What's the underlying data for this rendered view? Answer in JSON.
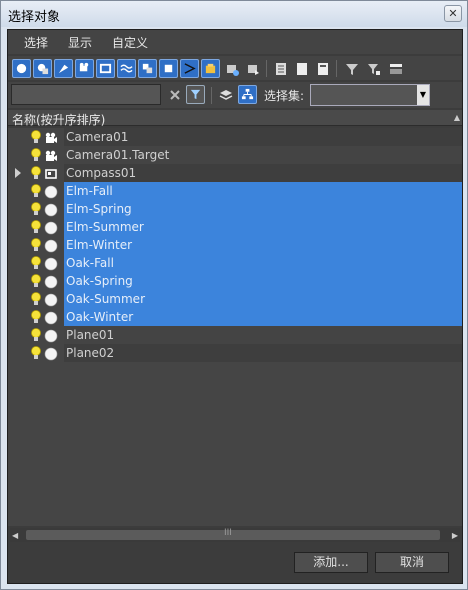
{
  "window": {
    "title": "选择对象",
    "close_glyph": "✕"
  },
  "menu": [
    "选择",
    "显示",
    "自定义"
  ],
  "filter": {
    "search_value": "",
    "selection_set_label": "选择集:",
    "selection_set_value": ""
  },
  "columns": {
    "name_header": "名称(按升序排序)"
  },
  "objects": [
    {
      "name": "Camera01",
      "icon": "camera-icon",
      "selected": false,
      "expandable": false
    },
    {
      "name": "Camera01.Target",
      "icon": "camera-icon",
      "selected": false,
      "expandable": false
    },
    {
      "name": "Compass01",
      "icon": "helper-icon",
      "selected": false,
      "expandable": true
    },
    {
      "name": "Elm-Fall",
      "icon": "geometry-sphere-icon",
      "selected": true,
      "expandable": false
    },
    {
      "name": "Elm-Spring",
      "icon": "geometry-sphere-icon",
      "selected": true,
      "expandable": false
    },
    {
      "name": "Elm-Summer",
      "icon": "geometry-sphere-icon",
      "selected": true,
      "expandable": false
    },
    {
      "name": "Elm-Winter",
      "icon": "geometry-sphere-icon",
      "selected": true,
      "expandable": false
    },
    {
      "name": "Oak-Fall",
      "icon": "geometry-sphere-icon",
      "selected": true,
      "expandable": false
    },
    {
      "name": "Oak-Spring",
      "icon": "geometry-sphere-icon",
      "selected": true,
      "expandable": false
    },
    {
      "name": "Oak-Summer",
      "icon": "geometry-sphere-icon",
      "selected": true,
      "expandable": false
    },
    {
      "name": "Oak-Winter",
      "icon": "geometry-sphere-icon",
      "selected": true,
      "expandable": false
    },
    {
      "name": "Plane01",
      "icon": "geometry-sphere-icon",
      "selected": false,
      "expandable": false
    },
    {
      "name": "Plane02",
      "icon": "geometry-sphere-icon",
      "selected": false,
      "expandable": false
    }
  ],
  "buttons": {
    "add": "添加...",
    "cancel": "取消"
  },
  "colors": {
    "selection": "#3c84dc",
    "panel": "#3c3c3c"
  }
}
